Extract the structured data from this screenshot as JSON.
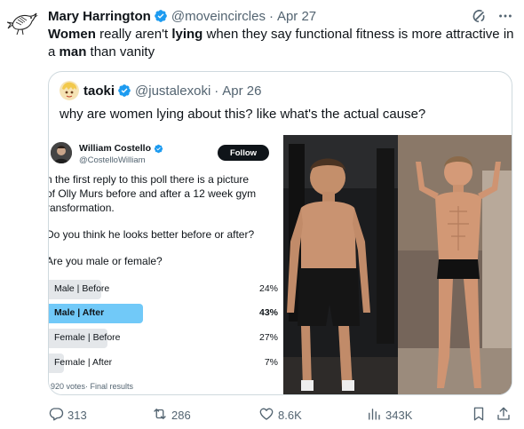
{
  "tweet": {
    "author_name": "Mary Harrington",
    "author_handle": "@moveincircles",
    "separator": "·",
    "date": "Apr 27",
    "text_parts": [
      "Women",
      " really aren't ",
      "lying",
      " when they say functional fitness is more attractive in a ",
      "man",
      " than vanity"
    ]
  },
  "quote": {
    "author_name": "taoki",
    "author_handle": "@justalexoki",
    "separator": "·",
    "date": "Apr 26",
    "text": "why are women lying about this? like what's the actual cause?"
  },
  "poll_screenshot": {
    "author_name": "William Costello",
    "author_handle": "@CostelloWilliam",
    "follow_label": "Follow",
    "body_lines": [
      "n the first reply to this poll there is a picture",
      "of Olly Murs before and after a 12 week gym",
      "ransformation.",
      "",
      "Do you think he looks better before or after?",
      "",
      "Are you male or female?"
    ],
    "options": [
      {
        "label": "Male | Before",
        "percent": "24%",
        "value": 24,
        "winner": false
      },
      {
        "label": "Male | After",
        "percent": "43%",
        "value": 43,
        "winner": true
      },
      {
        "label": "Female | Before",
        "percent": "27%",
        "value": 27,
        "winner": false
      },
      {
        "label": "Female | After",
        "percent": "7%",
        "value": 7,
        "winner": false
      }
    ],
    "footer": "920 votes· Final results"
  },
  "actions": {
    "replies": "313",
    "reposts": "286",
    "likes": "8.6K",
    "views": "343K"
  },
  "colors": {
    "verified": "#1d9bf0",
    "poll_winner": "#71c9f8",
    "poll_other": "#e4e7ea",
    "muted": "#536471"
  },
  "icons": [
    "verified-badge-icon",
    "grok-icon",
    "more-icon",
    "reply-icon",
    "repost-icon",
    "like-icon",
    "views-icon",
    "bookmark-icon",
    "share-icon"
  ]
}
